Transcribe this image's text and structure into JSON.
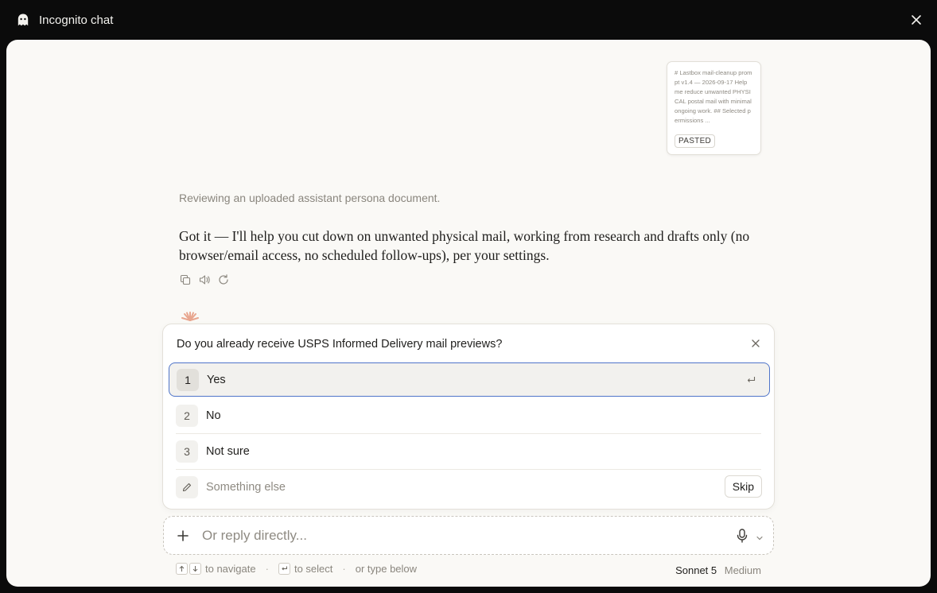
{
  "window": {
    "title": "Incognito chat",
    "icon": "ghost-icon",
    "close_icon": "close-icon"
  },
  "pasted": {
    "preview": "# Lastbox mail-cleanup prompt v1.4 — 2026-09-17 Help me reduce unwanted PHYSICAL postal mail with minimal ongoing work. ## Selected permissions ...",
    "badge": "PASTED"
  },
  "conversation": {
    "status": "Reviewing an uploaded assistant persona document.",
    "assistant_message": "Got it — I'll help you cut down on unwanted physical mail, working from research and drafts only (no browser/email access, no scheduled follow-ups), per your settings.",
    "actions": [
      "copy-icon",
      "speaker-icon",
      "retry-icon"
    ]
  },
  "question": {
    "text": "Do you already receive USPS Informed Delivery mail previews?",
    "options": [
      {
        "num": "1",
        "label": "Yes",
        "selected": true
      },
      {
        "num": "2",
        "label": "No",
        "selected": false
      },
      {
        "num": "3",
        "label": "Not sure",
        "selected": false
      }
    ],
    "other_placeholder": "Something else",
    "skip_label": "Skip"
  },
  "reply": {
    "placeholder": "Or reply directly..."
  },
  "hints": {
    "navigate": "to navigate",
    "select": "to select",
    "type_below": "or type below"
  },
  "model": {
    "name": "Sonnet 5",
    "effort": "Medium"
  },
  "colors": {
    "accent_border": "#4f74c9",
    "background_outer": "#0b0b0b",
    "pane": "#faf9f6",
    "spark": "#e8a68f"
  }
}
